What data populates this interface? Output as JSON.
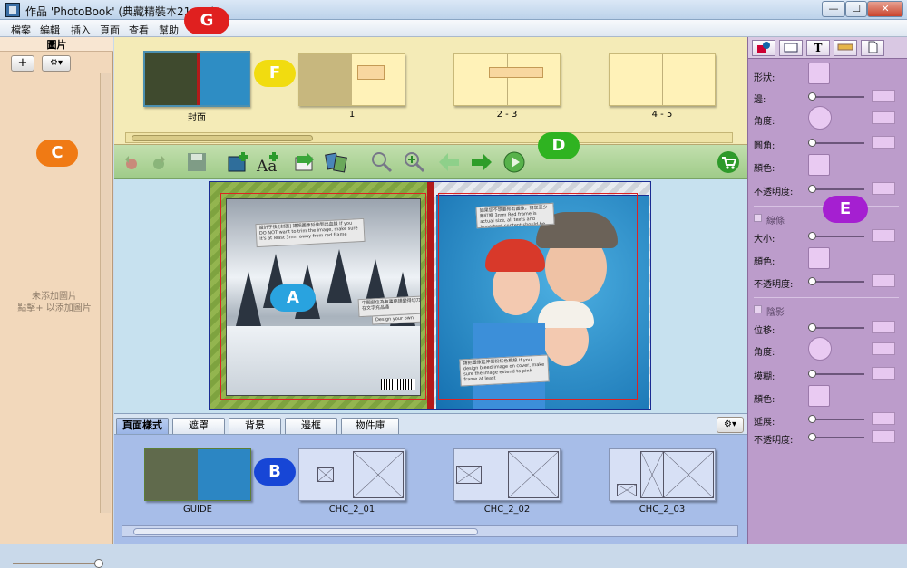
{
  "window": {
    "title": "作品 'PhotoBook' (典藏精裝本21x21)",
    "min": "—",
    "max": "☐",
    "close": "✕"
  },
  "menu": [
    "檔案",
    "編輯",
    "插入",
    "頁面",
    "查看",
    "幫助"
  ],
  "left_panel": {
    "title": "圖片",
    "add_label": "+",
    "settings_label": "⚙▾",
    "empty_line1": "未添加圖片",
    "empty_line2": "點擊+ 以添加圖片"
  },
  "pages_strip": {
    "items": [
      {
        "label": "封面"
      },
      {
        "label": "1"
      },
      {
        "label": "2 - 3"
      },
      {
        "label": "4 - 5"
      }
    ]
  },
  "toolbar": {
    "icons": [
      "undo-icon",
      "redo-icon",
      "save-icon",
      "add-photo-icon",
      "add-text-icon",
      "insert-icon",
      "replace-icon",
      "zoom-out-icon",
      "zoom-in-icon",
      "back-arrow-icon",
      "forward-arrow-icon",
      "play-icon",
      "cart-icon"
    ]
  },
  "canvas": {
    "left_notes": [
      "設計于後 [封面] 請把圖像延伸到出血線 If you DO NOT want to trim the image, make sure it's at least 3mm away from red frame",
      "中間部位為有事務請變得切刀打造在文字充品通",
      "Design your own spine here"
    ],
    "right_notes": [
      "如果您不想要修剪圖像，請您至少離紅框 3mm Red frame is actual size, all texts and important content should be within frame",
      "請把圖像延伸到粉紅色框線 If you design bleed image on cover, make sure the image extend to pink frame at least"
    ]
  },
  "tabs": [
    "頁面樣式",
    "遮罩",
    "背景",
    "邊框",
    "物件庫"
  ],
  "layouts": [
    {
      "label": "GUIDE"
    },
    {
      "label": "CHC_2_01"
    },
    {
      "label": "CHC_2_02"
    },
    {
      "label": "CHC_2_03"
    }
  ],
  "right_panel": {
    "tab_icons": [
      "shape-tab-icon",
      "frame-tab-icon",
      "text-tab-icon",
      "ruler-tab-icon",
      "page-tab-icon"
    ],
    "tab_text": "T",
    "shape_label": "形狀:",
    "edge_label": "邊:",
    "angle_label": "角度:",
    "corner_label": "圓角:",
    "color_label": "顏色:",
    "opacity_label": "不透明度:",
    "line_section": "線條",
    "size_label": "大小:",
    "line_color_label": "顏色:",
    "line_opacity_label": "不透明度:",
    "shadow_section": "陰影",
    "offset_label": "位移:",
    "shadow_angle_label": "角度:",
    "blur_label": "模糊:",
    "shadow_color_label": "顏色:",
    "spread_label": "延展:",
    "shadow_opacity_label": "不透明度:"
  },
  "callouts": {
    "A": "A",
    "B": "B",
    "C": "C",
    "D": "D",
    "E": "E",
    "F": "F",
    "G": "G"
  },
  "colors": {
    "callout_A": "#29a3df",
    "callout_B": "#1746d6",
    "callout_C": "#f07a14",
    "callout_D": "#2fb321",
    "callout_E": "#a51fd1",
    "callout_F": "#f1dc10",
    "callout_G": "#e0201f"
  }
}
